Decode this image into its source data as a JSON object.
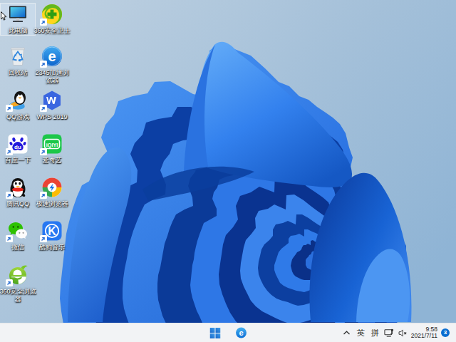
{
  "desktop": {
    "icons": [
      {
        "id": "this-pc",
        "label": "此电脑",
        "shortcut": false,
        "selected": true
      },
      {
        "id": "360-safe",
        "label": "360安全卫士",
        "shortcut": true,
        "selected": false
      },
      {
        "id": "recycle-bin",
        "label": "回收站",
        "shortcut": false,
        "selected": false
      },
      {
        "id": "2345-browser",
        "label": "2345加速浏览器",
        "shortcut": true,
        "selected": false
      },
      {
        "id": "qq-games",
        "label": "QQ游戏",
        "shortcut": true,
        "selected": false
      },
      {
        "id": "wps-2019",
        "label": "WPS 2019",
        "shortcut": true,
        "selected": false
      },
      {
        "id": "baidu",
        "label": "百度一下",
        "shortcut": true,
        "selected": false
      },
      {
        "id": "iqiyi",
        "label": "爱奇艺",
        "shortcut": true,
        "selected": false
      },
      {
        "id": "tencent-qq",
        "label": "腾讯QQ",
        "shortcut": true,
        "selected": false
      },
      {
        "id": "speed-browser",
        "label": "极速浏览器",
        "shortcut": true,
        "selected": false
      },
      {
        "id": "wechat",
        "label": "微信",
        "shortcut": true,
        "selected": false
      },
      {
        "id": "kugou-music",
        "label": "酷狗音乐",
        "shortcut": true,
        "selected": false
      },
      {
        "id": "360-browser",
        "label": "360安全浏览器",
        "shortcut": true,
        "selected": false
      }
    ]
  },
  "taskbar": {
    "start_tooltip": "开始",
    "tray": {
      "ime_english": "英",
      "ime_pinyin": "拼",
      "time": "9:58",
      "date": "2021/7/11",
      "notification_count": "3"
    }
  },
  "colors": {
    "accent_blue": "#0b6ed0",
    "taskbar_bg": "#f2f3f5",
    "wallpaper_sky": "#9bbbd9",
    "bloom_deep": "#0a3fa4",
    "bloom_bright": "#4f9bf4"
  }
}
